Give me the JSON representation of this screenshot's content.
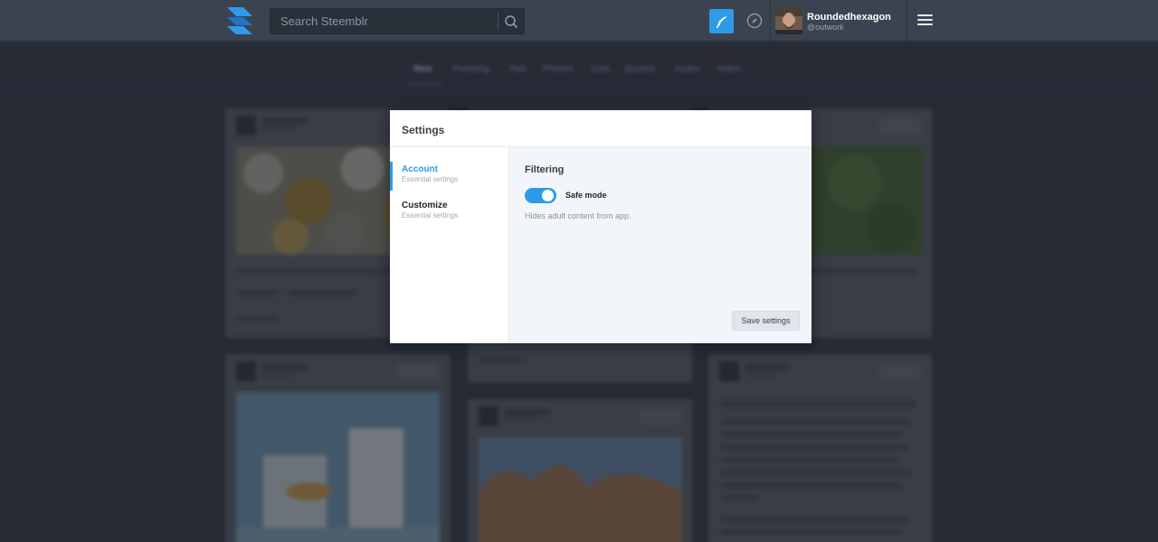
{
  "header": {
    "search_placeholder": "Search Steemblr",
    "user": {
      "name": "Roundedhexagon",
      "handle": "@outwork"
    }
  },
  "feed_tabs": [
    "New",
    "Trending",
    "Text",
    "Photos",
    "Cats",
    "Quotes",
    "Audio",
    "Video"
  ],
  "settings_modal": {
    "title": "Settings",
    "nav": [
      {
        "label": "Account",
        "sub": "Essential settings",
        "active": true
      },
      {
        "label": "Customize",
        "sub": "Essential settings",
        "active": false
      }
    ],
    "section_title": "Filtering",
    "safe_mode": {
      "label": "Safe mode",
      "enabled": true,
      "description": "Hides adult content from app."
    },
    "save_label": "Save settings"
  },
  "colors": {
    "accent": "#2e9ae8",
    "topbar": "#3b4350",
    "background": "#2e3541",
    "modal_content": "#f2f5f9"
  }
}
